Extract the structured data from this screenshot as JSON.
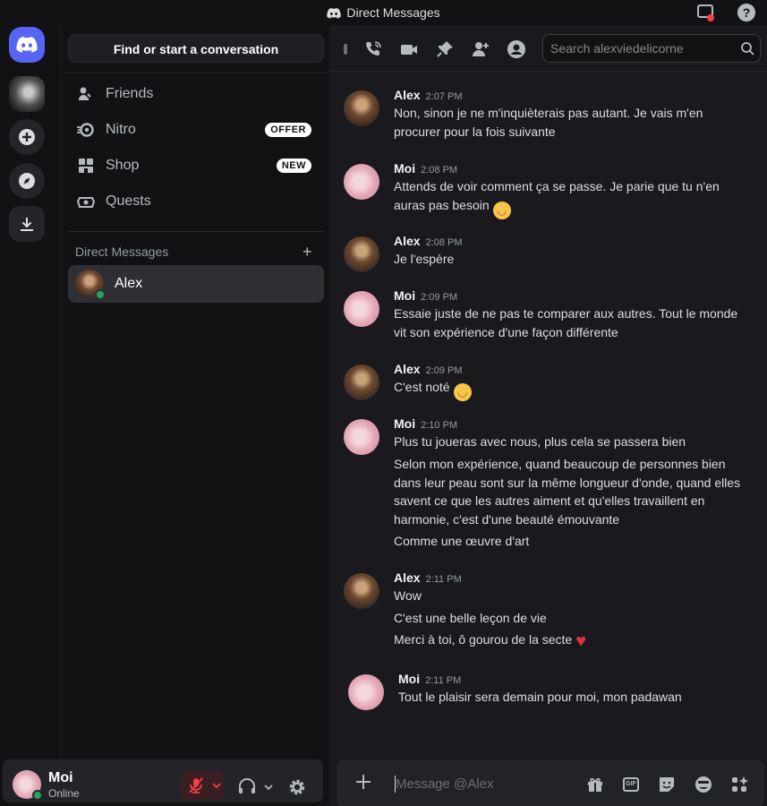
{
  "window": {
    "title": "Direct Messages"
  },
  "dm_column": {
    "find_label": "Find or start a conversation",
    "nav": [
      {
        "label": "Friends",
        "icon": "friends-icon"
      },
      {
        "label": "Nitro",
        "icon": "nitro-icon",
        "badge": "OFFER"
      },
      {
        "label": "Shop",
        "icon": "shop-icon",
        "badge": "NEW"
      },
      {
        "label": "Quests",
        "icon": "quests-icon"
      }
    ],
    "dm_header": "Direct Messages",
    "dm_add": "+",
    "conversations": [
      {
        "name": "Alex",
        "status": "online"
      }
    ]
  },
  "user_panel": {
    "name": "Moi",
    "status": "Online"
  },
  "chat": {
    "search_placeholder": "Search alexviedelicorne",
    "composer_placeholder": "Message @Alex",
    "messages": [
      {
        "author": "Alex",
        "time": "2:07 PM",
        "lines": [
          "Non, sinon je ne m'inquièterais pas autant. Je vais m'en procurer pour la fois suivante"
        ]
      },
      {
        "author": "Moi",
        "time": "2:08 PM",
        "lines": [
          "Attends de voir comment ça se passe. Je parie que tu n'en auras pas besoin"
        ]
      },
      {
        "author": "Alex",
        "time": "2:08 PM",
        "lines": [
          "Je l'espère"
        ]
      },
      {
        "author": "Moi",
        "time": "2:09 PM",
        "lines": [
          "Essaie juste de ne pas te comparer aux autres. Tout le monde vit son expérience d'une façon différente"
        ]
      },
      {
        "author": "Alex",
        "time": "2:09 PM",
        "lines": [
          "C'est noté"
        ]
      },
      {
        "author": "Moi",
        "time": "2:10 PM",
        "lines": [
          "Plus tu joueras avec nous, plus cela se passera bien",
          "Selon mon expérience, quand beaucoup de personnes bien dans leur peau sont sur la même longueur d'onde, quand elles savent ce que les autres aiment et qu'elles travaillent en harmonie, c'est d'une beauté émouvante",
          "Comme une œuvre d'art"
        ]
      },
      {
        "author": "Alex",
        "time": "2:11 PM",
        "lines": [
          "Wow",
          "C'est une belle leçon de vie",
          "Merci à toi, ô gourou de la secte"
        ]
      },
      {
        "author": "Moi",
        "time": "2:11 PM",
        "lines": [
          "Tout le plaisir sera demain pour moi, mon padawan"
        ]
      }
    ]
  },
  "colors": {
    "accent": "#5865f2",
    "online": "#23a55a",
    "heart": "#e03044"
  }
}
